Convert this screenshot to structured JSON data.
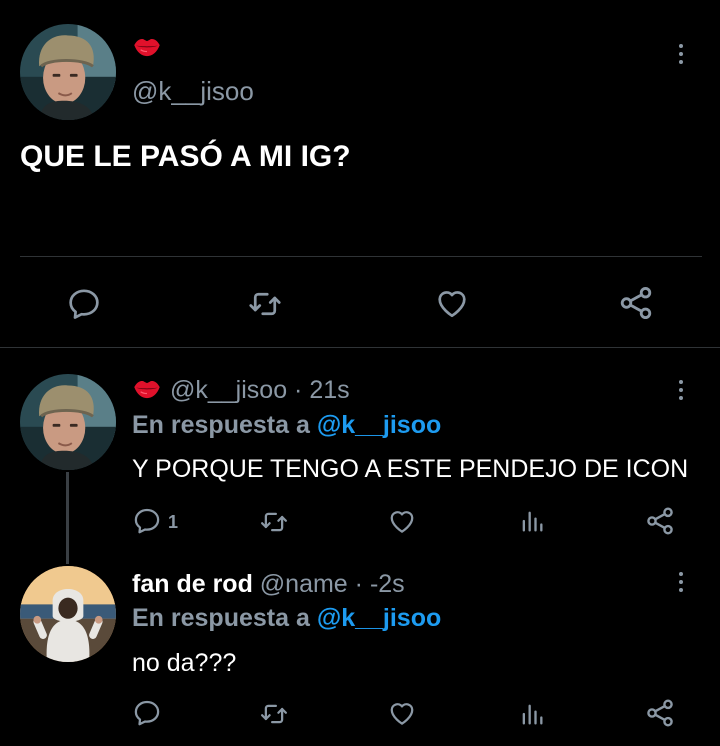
{
  "colors": {
    "background": "#000000",
    "text": "#ffffff",
    "muted": "#8b98a5",
    "link": "#1d9bf0",
    "divider": "#2f3336",
    "lips": "#e0112b"
  },
  "main_tweet": {
    "name_emoji": "kiss-mark-lips",
    "handle": "@k__jisoo",
    "text": "QUE LE PASÓ A MI IG?",
    "actions": [
      "reply-icon",
      "retweet-icon",
      "like-icon",
      "share-icon"
    ],
    "menu_icon": "more-vertical-icon"
  },
  "replies": [
    {
      "name_emoji": "kiss-mark-lips",
      "handle": "@k__jisoo",
      "separator": " · ",
      "time": "21s",
      "in_reply_prefix": "En respuesta a ",
      "in_reply_to": "@k__jisoo",
      "text": "Y PORQUE TENGO A ESTE PENDEJO DE ICON",
      "reply_count": "1",
      "actions": [
        "reply-icon",
        "retweet-icon",
        "like-icon",
        "analytics-icon",
        "share-icon"
      ],
      "menu_icon": "more-vertical-icon"
    },
    {
      "name": "fan de rod",
      "handle": "@name",
      "separator": " · ",
      "time": "-2s",
      "in_reply_prefix": "En respuesta a ",
      "in_reply_to": "@k__jisoo",
      "text": "no da???",
      "actions": [
        "reply-icon",
        "retweet-icon",
        "like-icon",
        "analytics-icon",
        "share-icon"
      ],
      "menu_icon": "more-vertical-icon"
    }
  ]
}
